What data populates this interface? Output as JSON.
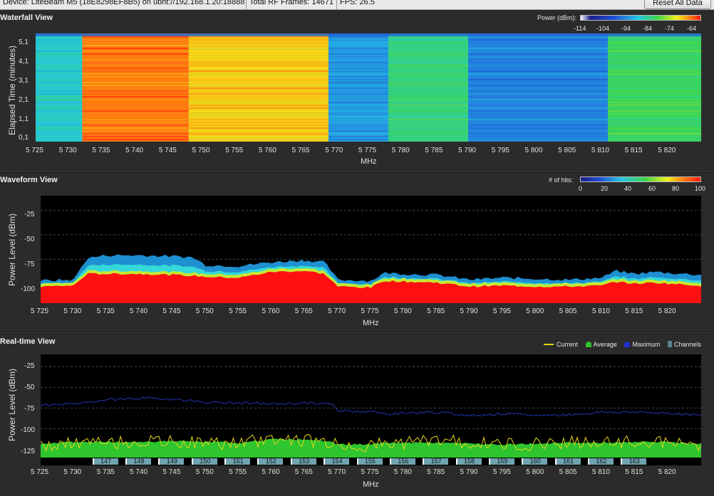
{
  "topbar": {
    "device": "Device: LiteBeam M5 (18E8298EF8B5) on ubnt://192.168.1.20:18888",
    "frames": "Total RF Frames: 14671",
    "fps": "FPS: 26.5",
    "reset_label": "Reset All Data"
  },
  "waterfall": {
    "title": "Waterfall View",
    "ylabel": "Elapsed Time (minutes)",
    "yticks": [
      "5,1",
      "4,1",
      "3,1",
      "2,1",
      "1,1",
      "0,1"
    ],
    "legend_label": "Power (dBm):",
    "legend_ticks": [
      "-114",
      "-104",
      "-94",
      "-84",
      "-74",
      "-64"
    ]
  },
  "waveform": {
    "title": "Waveform View",
    "ylabel": "Power Level (dBm)",
    "yticks": [
      "-25",
      "-50",
      "-75",
      "-100"
    ],
    "legend_label": "# of hits:",
    "legend_ticks": [
      "0",
      "20",
      "40",
      "60",
      "80",
      "100"
    ]
  },
  "realtime": {
    "title": "Real-time View",
    "ylabel": "Power Level (dBm)",
    "yticks": [
      "-25",
      "-50",
      "-75",
      "-100",
      "-125"
    ],
    "legend": {
      "current": "Current",
      "average": "Average",
      "maximum": "Maximum",
      "channels": "Channels"
    },
    "channels": [
      "147",
      "148",
      "149",
      "150",
      "151",
      "152",
      "153",
      "154",
      "155",
      "156",
      "157",
      "158",
      "159",
      "160",
      "161",
      "162",
      "163"
    ]
  },
  "xaxis": {
    "unit": "MHz",
    "ticks": [
      "5 725",
      "5 730",
      "5 735",
      "5 740",
      "5 745",
      "5 750",
      "5 755",
      "5 760",
      "5 765",
      "5 770",
      "5 775",
      "5 780",
      "5 785",
      "5 790",
      "5 795",
      "5 800",
      "5 805",
      "5 810",
      "5 815",
      "5 820"
    ]
  },
  "colors": {
    "current": "#e6d619",
    "average": "#2ec52e",
    "maximum": "#1e2a8c",
    "channel": "#6fa3ae",
    "background": "#2b2b2b"
  },
  "chart_data": [
    {
      "type": "heatmap",
      "title": "Waterfall View",
      "xlabel": "MHz",
      "ylabel": "Elapsed Time (minutes)",
      "xlim": [
        5725,
        5825
      ],
      "ylim": [
        0.1,
        5.6
      ],
      "color_scale": {
        "label": "Power (dBm):",
        "range": [
          -114,
          -64
        ]
      },
      "bands": [
        {
          "x": [
            5725,
            5732
          ],
          "power_dbm": -90
        },
        {
          "x": [
            5732,
            5748
          ],
          "power_dbm": -68
        },
        {
          "x": [
            5748,
            5769
          ],
          "power_dbm": -72
        },
        {
          "x": [
            5769,
            5778
          ],
          "power_dbm": -95
        },
        {
          "x": [
            5778,
            5790
          ],
          "power_dbm": -86
        },
        {
          "x": [
            5790,
            5811
          ],
          "power_dbm": -97
        },
        {
          "x": [
            5811,
            5825
          ],
          "power_dbm": -84
        }
      ]
    },
    {
      "type": "area",
      "title": "Waveform View",
      "xlabel": "MHz",
      "ylabel": "Power Level (dBm)",
      "xlim": [
        5725,
        5825
      ],
      "ylim": [
        -120,
        -10
      ],
      "color_scale": {
        "label": "# of hits:",
        "range": [
          0,
          100
        ]
      },
      "x": [
        5725,
        5730,
        5732,
        5735,
        5740,
        5745,
        5748,
        5750,
        5755,
        5760,
        5765,
        5768,
        5770,
        5775,
        5777,
        5780,
        5785,
        5790,
        5795,
        5800,
        5805,
        5810,
        5812,
        5815,
        5818,
        5820,
        5825
      ],
      "series": [
        {
          "name": "Maximum",
          "values": [
            -97,
            -96,
            -74,
            -71,
            -71,
            -72,
            -73,
            -81,
            -82,
            -78,
            -76,
            -78,
            -96,
            -97,
            -89,
            -90,
            -91,
            -96,
            -94,
            -95,
            -96,
            -94,
            -87,
            -90,
            -88,
            -89,
            -91
          ]
        },
        {
          "name": "Average",
          "values": [
            -103,
            -102,
            -90,
            -90,
            -90,
            -91,
            -92,
            -93,
            -94,
            -88,
            -87,
            -90,
            -103,
            -104,
            -97,
            -98,
            -99,
            -103,
            -102,
            -103,
            -103,
            -102,
            -98,
            -100,
            -99,
            -100,
            -102
          ]
        }
      ]
    },
    {
      "type": "line",
      "title": "Real-time View",
      "xlabel": "MHz",
      "ylabel": "Power Level (dBm)",
      "xlim": [
        5725,
        5825
      ],
      "ylim": [
        -135,
        -10
      ],
      "x": [
        5725,
        5730,
        5735,
        5740,
        5745,
        5750,
        5755,
        5760,
        5765,
        5769,
        5770,
        5775,
        5777,
        5780,
        5785,
        5790,
        5795,
        5800,
        5805,
        5810,
        5815,
        5820,
        5825
      ],
      "series": [
        {
          "name": "Current",
          "values": [
            -122,
            -118,
            -117,
            -116,
            -116,
            -117,
            -118,
            -112,
            -114,
            -117,
            -120,
            -121,
            -118,
            -117,
            -113,
            -118,
            -119,
            -118,
            -116,
            -118,
            -116,
            -117,
            -121
          ]
        },
        {
          "name": "Average",
          "values": [
            -118,
            -116,
            -116,
            -116,
            -115,
            -116,
            -117,
            -113,
            -113,
            -116,
            -119,
            -119,
            -117,
            -117,
            -117,
            -118,
            -119,
            -118,
            -117,
            -117,
            -116,
            -116,
            -118
          ]
        },
        {
          "name": "Maximum",
          "values": [
            -72,
            -70,
            -65,
            -63,
            -64,
            -68,
            -69,
            -70,
            -69,
            -70,
            -78,
            -79,
            -82,
            -81,
            -80,
            -84,
            -82,
            -84,
            -83,
            -80,
            -80,
            -81,
            -84
          ]
        }
      ],
      "channels": [
        "147",
        "148",
        "149",
        "150",
        "151",
        "152",
        "153",
        "154",
        "155",
        "156",
        "157",
        "158",
        "159",
        "160",
        "161",
        "162",
        "163"
      ]
    }
  ]
}
